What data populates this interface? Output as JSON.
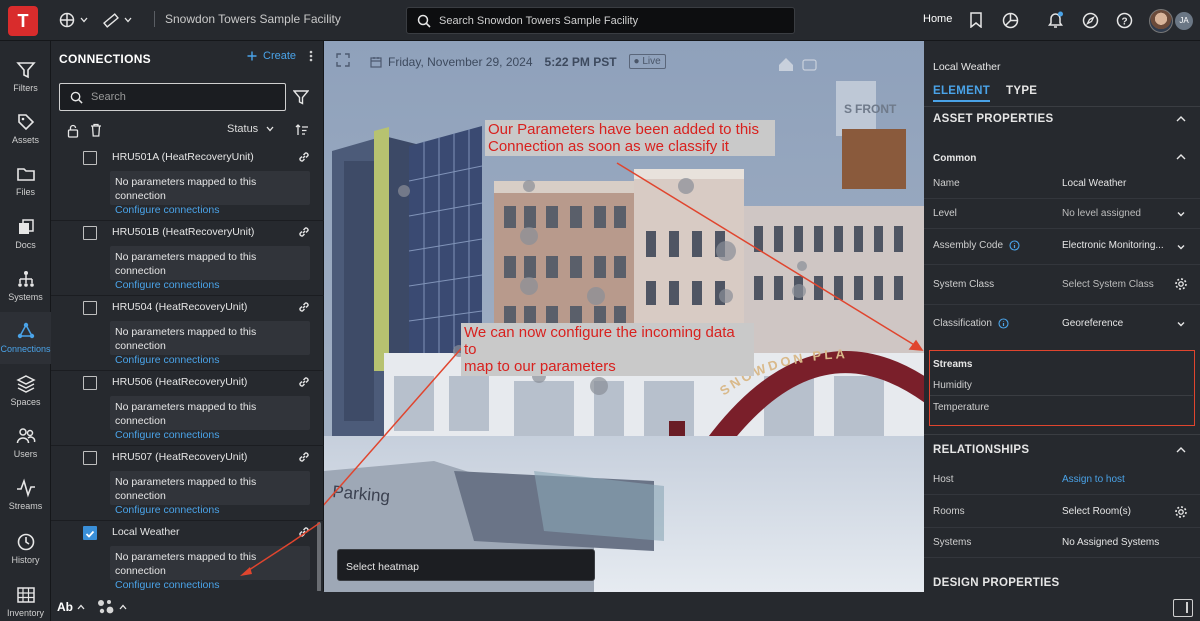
{
  "app": {
    "logo_letter": "T",
    "facility_title": "Snowdon Towers Sample Facility",
    "search_placeholder": "Search Snowdon Towers Sample Facility",
    "home_label": "Home",
    "user_initials": "JA"
  },
  "rail": {
    "items": [
      {
        "label": "Filters",
        "icon": "filter-icon"
      },
      {
        "label": "Assets",
        "icon": "tag-icon"
      },
      {
        "label": "Files",
        "icon": "folder-icon"
      },
      {
        "label": "Docs",
        "icon": "documents-icon"
      },
      {
        "label": "Systems",
        "icon": "hierarchy-icon"
      },
      {
        "label": "Connections",
        "icon": "connections-icon",
        "active": true
      },
      {
        "label": "Spaces",
        "icon": "layers-icon"
      },
      {
        "label": "Users",
        "icon": "users-icon"
      },
      {
        "label": "Streams",
        "icon": "pulse-icon"
      },
      {
        "label": "History",
        "icon": "history-icon"
      },
      {
        "label": "Inventory",
        "icon": "table-icon"
      }
    ]
  },
  "connections_panel": {
    "title": "CONNECTIONS",
    "create_label": "Create",
    "search_placeholder": "Search",
    "sort_label": "Status",
    "items": [
      {
        "name": "HRU501A (HeatRecoveryUnit)",
        "message": "No parameters mapped to this connection",
        "action": "Configure connections",
        "checked": false
      },
      {
        "name": "HRU501B (HeatRecoveryUnit)",
        "message": "No parameters mapped to this connection",
        "action": "Configure connections",
        "checked": false
      },
      {
        "name": "HRU504 (HeatRecoveryUnit)",
        "message": "No parameters mapped to this connection",
        "action": "Configure connections",
        "checked": false
      },
      {
        "name": "HRU506 (HeatRecoveryUnit)",
        "message": "No parameters mapped to this connection",
        "action": "Configure connections",
        "checked": false
      },
      {
        "name": "HRU507 (HeatRecoveryUnit)",
        "message": "No parameters mapped to this connection",
        "action": "Configure connections",
        "checked": false
      },
      {
        "name": "Local Weather",
        "message": "No parameters mapped to this connection",
        "action": "Configure connections",
        "checked": true
      }
    ],
    "bottom_label": "Ab"
  },
  "viewport": {
    "date": "Friday, November 29, 2024",
    "time": "5:22 PM PST",
    "live_label": "Live",
    "heatmap_label": "Select heatmap",
    "scene_text": {
      "front": "FRONT",
      "front_prefix": "S",
      "sign": "SNOWDON PLA",
      "parking": "Parking"
    },
    "callouts": [
      {
        "line1": "Our Parameters have been added to this",
        "line2": "Connection as soon as we classify it"
      },
      {
        "line1": "We can now configure the incoming data to",
        "line2": "map to our parameters"
      }
    ],
    "colors": {
      "callout_text": "#d8211e",
      "arrow": "#e0452e"
    }
  },
  "properties": {
    "title": "Local Weather",
    "tabs": [
      {
        "label": "ELEMENT",
        "active": true
      },
      {
        "label": "TYPE",
        "active": false
      }
    ],
    "asset_properties_heading": "ASSET PROPERTIES",
    "common_heading": "Common",
    "rows": [
      {
        "key": "Name",
        "value": "Local Weather"
      },
      {
        "key": "Level",
        "value": "No level assigned"
      },
      {
        "key": "Assembly Code",
        "value": "Electronic Monitoring..."
      },
      {
        "key": "System Class",
        "value": "Select System Class"
      },
      {
        "key": "Classification",
        "value": "Georeference"
      }
    ],
    "streams_heading": "Streams",
    "streams": [
      "Humidity",
      "Temperature"
    ],
    "relationships_heading": "RELATIONSHIPS",
    "relationships": [
      {
        "key": "Host",
        "value": "Assign to host"
      },
      {
        "key": "Rooms",
        "value": "Select Room(s)"
      },
      {
        "key": "Systems",
        "value": "No Assigned Systems"
      }
    ],
    "design_heading": "DESIGN PROPERTIES"
  }
}
